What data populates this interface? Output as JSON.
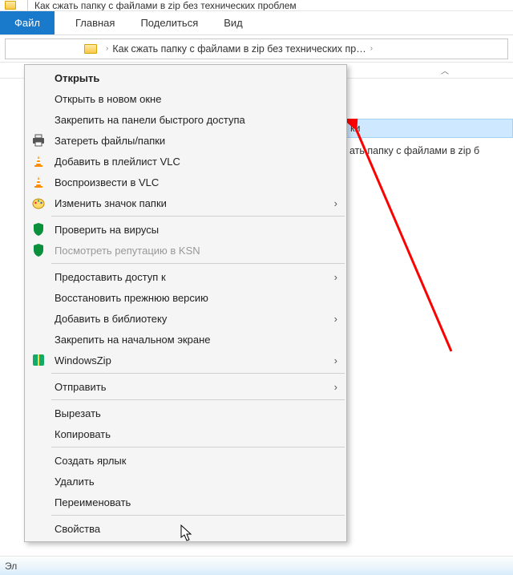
{
  "window": {
    "title": "Как сжать папку с файлами в zip  без технических проблем"
  },
  "ribbon": {
    "file": "Файл",
    "tabs": [
      "Главная",
      "Поделиться",
      "Вид"
    ]
  },
  "addrbar": {
    "crumb": "Как сжать папку с файлами в zip  без технических пр…"
  },
  "list": {
    "header_suffix": "ки",
    "row_suffix": "ать папку с файлами в zip  б"
  },
  "status": {
    "prefix": "Эл"
  },
  "context_menu": {
    "open": "Открыть",
    "open_new_window": "Открыть в новом окне",
    "pin_quick_access": "Закрепить на панели быстрого доступа",
    "wipe": "Затереть файлы/папки",
    "vlc_add": "Добавить в плейлист VLC",
    "vlc_play": "Воспроизвести в VLC",
    "change_icon": "Изменить значок папки",
    "av_scan": "Проверить на вирусы",
    "ksn": "Посмотреть репутацию в KSN",
    "share_access": "Предоставить доступ к",
    "restore_prev": "Восстановить прежнюю версию",
    "add_library": "Добавить в библиотеку",
    "pin_start": "Закрепить на начальном экране",
    "winzip": "WindowsZip",
    "send_to": "Отправить",
    "cut": "Вырезать",
    "copy": "Копировать",
    "create_shortcut": "Создать ярлык",
    "delete": "Удалить",
    "rename": "Переименовать",
    "properties": "Свойства"
  }
}
